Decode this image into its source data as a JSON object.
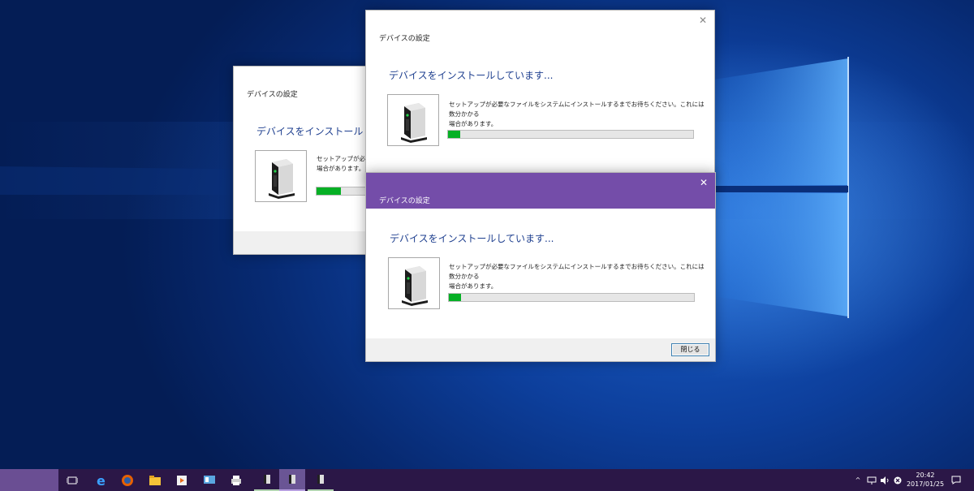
{
  "colors": {
    "active_title": "#744da9",
    "heading": "#1e3f8f",
    "progress_fill": "#06b025",
    "taskbar": "#2b1747"
  },
  "dialogs": {
    "back_left": {
      "title": "デバイスの設定",
      "heading": "デバイスをインストールしています...",
      "desc": "セットアップが必要なファイルをシステムにインストールするまでお待ちください。これには数分かかる\n場合があります。",
      "progress": 0.1
    },
    "back_right": {
      "title": "デバイスの設定",
      "heading": "デバイスをインストールしています...",
      "desc": "セットアップが必要なファイルをシステムにインストールするまでお待ちください。これには数分かかる\n場合があります。",
      "progress": 0.05
    },
    "front": {
      "title": "デバイスの設定",
      "heading": "デバイスをインストールしています...",
      "desc": "セットアップが必要なファイルをシステムにインストールするまでお待ちください。これには数分かかる\n場合があります。",
      "progress": 0.05,
      "close_label": "閉じる"
    }
  },
  "taskbar": {
    "icons": [
      "task-view-icon",
      "edge-icon",
      "firefox-icon",
      "file-explorer-icon",
      "media-player-icon",
      "control-panel-icon",
      "printer-icon",
      "device-setup-icon",
      "device-setup-icon",
      "device-setup-icon"
    ],
    "time": "20:42",
    "date": "2017/01/25"
  }
}
